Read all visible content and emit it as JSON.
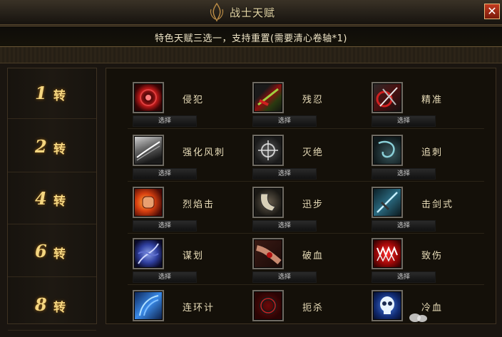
{
  "window": {
    "title": "战士天赋",
    "close_label": "✕"
  },
  "banner": {
    "text": "特色天赋三选一，支持重置(需要清心卷轴*1)"
  },
  "tiers": [
    {
      "number": "1",
      "unit": "转"
    },
    {
      "number": "2",
      "unit": "转"
    },
    {
      "number": "4",
      "unit": "转"
    },
    {
      "number": "6",
      "unit": "转"
    },
    {
      "number": "8",
      "unit": "转"
    }
  ],
  "select_label": "选择",
  "rows": [
    {
      "skills": [
        {
          "name": "侵犯",
          "icon": "red-orb-icon"
        },
        {
          "name": "残忍",
          "icon": "bloody-blade-icon"
        },
        {
          "name": "精准",
          "icon": "crossed-swords-icon"
        }
      ]
    },
    {
      "skills": [
        {
          "name": "强化风刺",
          "icon": "wind-slash-icon"
        },
        {
          "name": "灭绝",
          "icon": "crosshair-icon"
        },
        {
          "name": "追刺",
          "icon": "dark-whirl-icon"
        }
      ]
    },
    {
      "skills": [
        {
          "name": "烈焰击",
          "icon": "flaming-fist-icon"
        },
        {
          "name": "迅步",
          "icon": "claw-boot-icon"
        },
        {
          "name": "击剑式",
          "icon": "blue-sword-icon"
        }
      ]
    },
    {
      "skills": [
        {
          "name": "谋划",
          "icon": "blue-vortex-icon"
        },
        {
          "name": "破血",
          "icon": "bleeding-arm-icon"
        },
        {
          "name": "致伤",
          "icon": "fanged-maw-icon"
        }
      ]
    },
    {
      "skills": [
        {
          "name": "连环计",
          "icon": "blue-arcs-icon"
        },
        {
          "name": "扼杀",
          "icon": "red-ring-icon"
        },
        {
          "name": "冷血",
          "icon": "ice-skull-icon"
        }
      ]
    }
  ],
  "colors": {
    "gold": "#f5d680",
    "panel": "#141009",
    "accent_red": "#c23a1f"
  }
}
